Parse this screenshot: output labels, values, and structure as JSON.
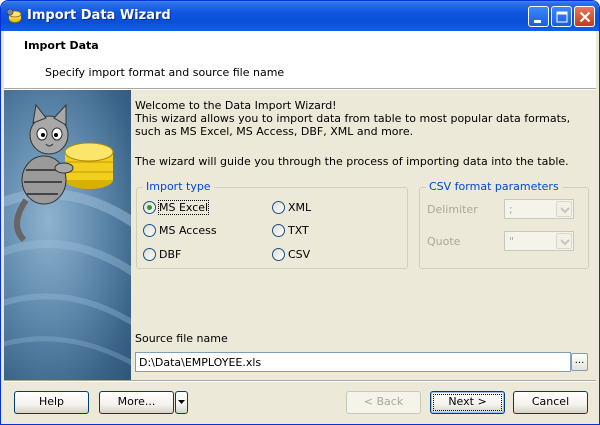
{
  "window": {
    "title": "Import Data Wizard",
    "title_icon": "app-icon",
    "controls": [
      "minimize-icon",
      "maximize-icon",
      "close-icon"
    ]
  },
  "header": {
    "title": "Import Data",
    "subtitle": "Specify import format and source file name"
  },
  "intro": {
    "line1": "Welcome to the Data Import Wizard!",
    "line2": "This wizard allows you to import data from table to most popular data formats, such as MS Excel, MS Access, DBF, XML and more.",
    "guide": "The wizard will guide you through the process of importing data into the table."
  },
  "import_type": {
    "legend": "Import type",
    "selected": "MS Excel",
    "options": [
      "MS Excel",
      "MS Access",
      "DBF",
      "XML",
      "TXT",
      "CSV"
    ]
  },
  "csv_params": {
    "legend": "CSV format parameters",
    "delimiter_label": "Delimiter",
    "delimiter_value": ";",
    "quote_label": "Quote",
    "quote_value": "\""
  },
  "source": {
    "label": "Source file name",
    "value": "D:\\Data\\EMPLOYEE.xls",
    "browse_label": "..."
  },
  "buttons": {
    "help": "Help",
    "more": "More...",
    "back": "< Back",
    "next": "Next >",
    "cancel": "Cancel"
  },
  "colors": {
    "titlebar": "#0a4fd6",
    "group_legend": "#0046d5",
    "radio_checked": "#21a121",
    "window_bg": "#ece9d8"
  }
}
